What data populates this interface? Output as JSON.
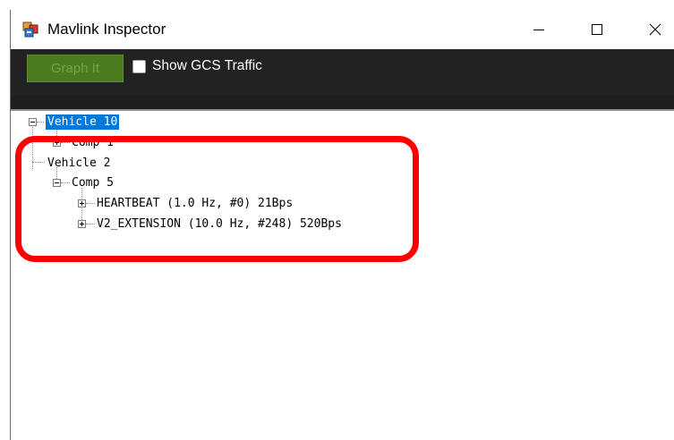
{
  "window": {
    "title": "Mavlink Inspector",
    "app_icon": "app-window-icon",
    "caption_buttons": [
      "minimize-icon",
      "maximize-icon",
      "close-icon"
    ]
  },
  "toolbar": {
    "graph_button_label": "Graph It",
    "gcs_checkbox_label": "Show GCS Traffic",
    "gcs_checkbox_checked": false,
    "background_color": "#222222",
    "graph_button_color": "#4a7b1c"
  },
  "tree": {
    "nodes": [
      {
        "label": "Vehicle 10",
        "expanded": true,
        "selected": true,
        "children": [
          {
            "label": "Comp 1",
            "expanded": false
          }
        ]
      },
      {
        "label": "Vehicle 2",
        "expanded": true,
        "selected": false,
        "children": [
          {
            "label": "Comp 5",
            "expanded": true,
            "children": [
              {
                "label": "HEARTBEAT (1.0 Hz, #0) 21Bps",
                "expanded": false
              },
              {
                "label": "V2_EXTENSION (10.0 Hz, #248) 520Bps",
                "expanded": false
              }
            ]
          }
        ]
      }
    ],
    "selection_color": "#0078d7"
  },
  "annotation": {
    "shape": "rounded-rectangle",
    "color": "#ff0000"
  }
}
